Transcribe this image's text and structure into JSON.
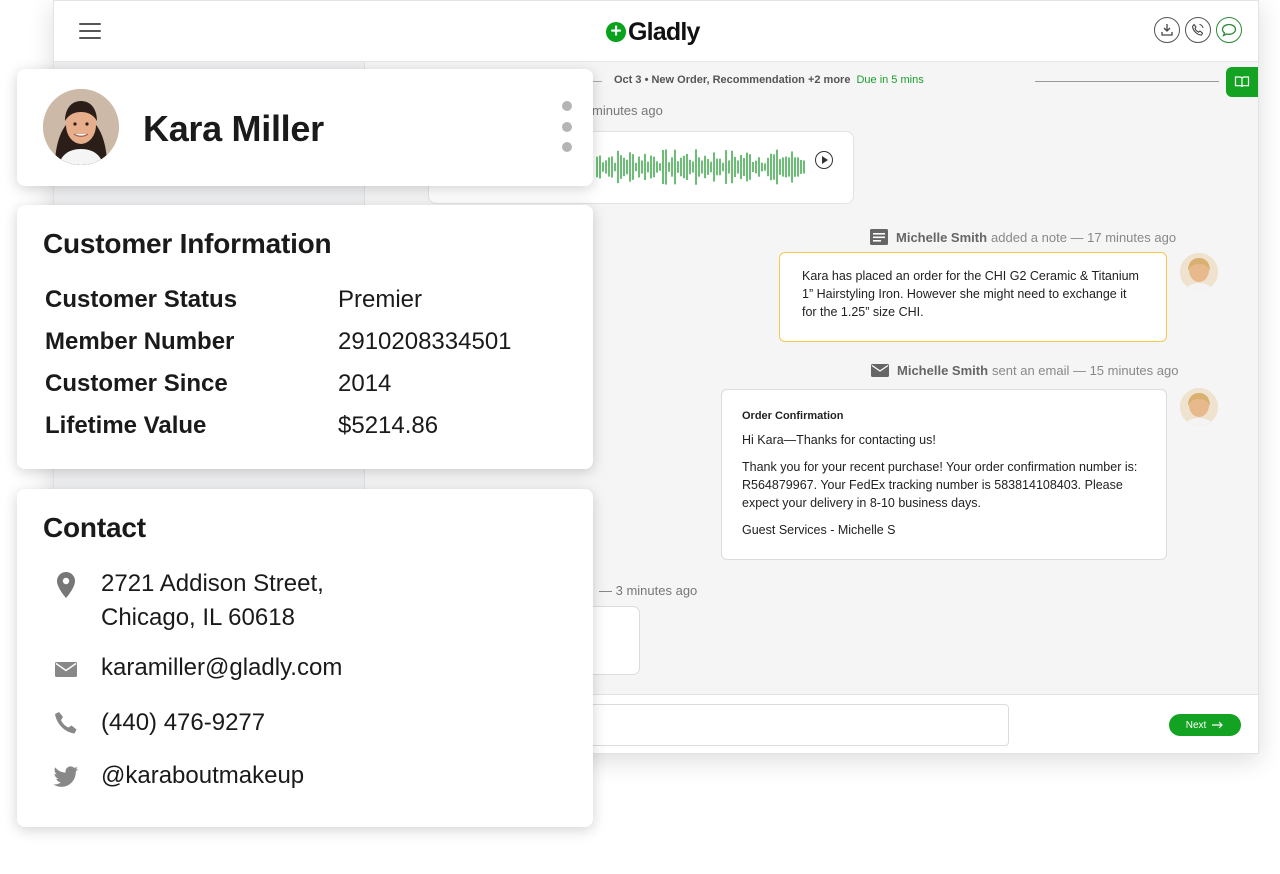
{
  "app": {
    "logo_text": "Gladly",
    "timeline": {
      "text": "Oct 3 • New Order, Recommendation +2 more",
      "due": "Due in 5 mins"
    },
    "messages": {
      "audio_meta": "minutes ago",
      "note_meta": {
        "author": "Michelle Smith",
        "action": "added a note — 17 minutes ago"
      },
      "note_text": "Kara has placed an order for the CHI G2 Ceramic & Titanium 1” Hairstyling Iron. However she might need to exchange it for the 1.25” size CHI.",
      "email_meta": {
        "author": "Michelle Smith",
        "action": "sent an email — 15 minutes ago"
      },
      "email": {
        "subject": "Order Confirmation",
        "greeting": "Hi Kara—Thanks for contacting us!",
        "body": "Thank you for your recent purchase! Your order confirmation number is: R564879967. Your FedEx tracking number is 583814108403. Please expect your delivery in 8-10 business days.",
        "signature": "Guest Services - Michelle S"
      },
      "last_meta": "— 3 minutes ago"
    },
    "next_label": "Next",
    "accent": "#13a221"
  },
  "customer": {
    "name": "Kara Miller",
    "info_title": "Customer Information",
    "fields": [
      {
        "label": "Customer Status",
        "value": "Premier"
      },
      {
        "label": "Member Number",
        "value": "2910208334501"
      },
      {
        "label": "Customer Since",
        "value": "2014"
      },
      {
        "label": "Lifetime Value",
        "value": "$5214.86"
      }
    ]
  },
  "contact": {
    "title": "Contact",
    "address_line1": "2721 Addison Street,",
    "address_line2": "Chicago, IL 60618",
    "email": "karamiller@gladly.com",
    "phone": "(440) 476-9277",
    "twitter": "@karaboutmakeup"
  }
}
